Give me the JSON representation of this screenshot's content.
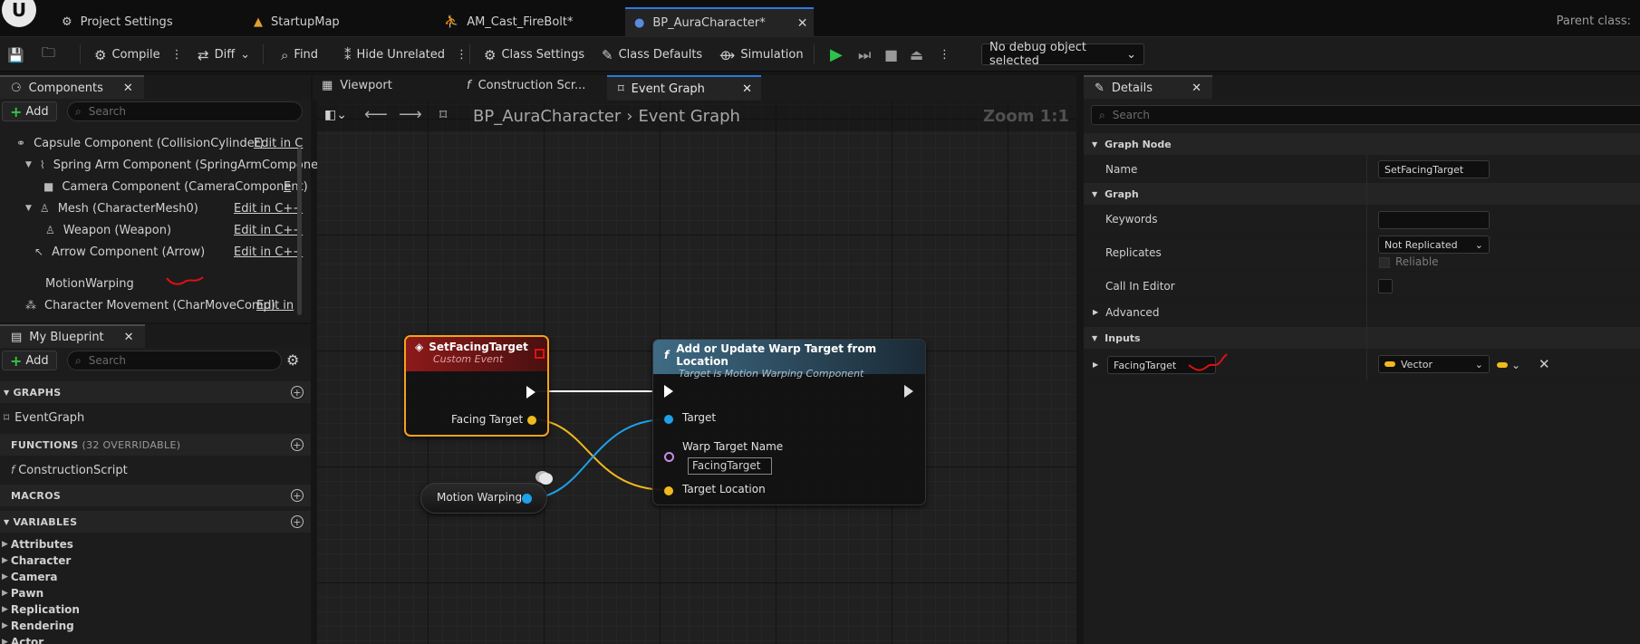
{
  "tabs": [
    {
      "label": "Project Settings",
      "icon": "settings-icon"
    },
    {
      "label": "StartupMap",
      "icon": "map-icon"
    },
    {
      "label": "AM_Cast_FireBolt*",
      "icon": "montage-icon"
    },
    {
      "label": "BP_AuraCharacter*",
      "icon": "character-icon",
      "active": true
    }
  ],
  "parent_class_label": "Parent class:",
  "toolbar": {
    "compile": "Compile",
    "diff": "Diff",
    "find": "Find",
    "hide_unrelated": "Hide Unrelated",
    "class_settings": "Class Settings",
    "class_defaults": "Class Defaults",
    "simulation": "Simulation",
    "debug_object": "No debug object selected"
  },
  "components": {
    "title": "Components",
    "add_label": "Add",
    "search_placeholder": "Search",
    "items": [
      {
        "label": "Capsule Component (CollisionCylinder)",
        "edit": "Edit in C"
      },
      {
        "label": "Spring Arm Component (SpringArmComponen",
        "edit": ""
      },
      {
        "label": "Camera Component (CameraComponent)",
        "edit": "E"
      },
      {
        "label": "Mesh (CharacterMesh0)",
        "edit": "Edit in C++"
      },
      {
        "label": "Weapon (Weapon)",
        "edit": "Edit in C++"
      },
      {
        "label": "Arrow Component (Arrow)",
        "edit": "Edit in C++"
      },
      {
        "label": "MotionWarping",
        "edit": ""
      },
      {
        "label": "Character Movement (CharMoveComp)",
        "edit": "Edit in"
      }
    ]
  },
  "my_blueprint": {
    "title": "My Blueprint",
    "add_label": "Add",
    "search_placeholder": "Search",
    "graphs_header": "GRAPHS",
    "graph_item": "EventGraph",
    "functions_header": "FUNCTIONS",
    "functions_count": "(32 OVERRIDABLE)",
    "function_item": "ConstructionScript",
    "macros_header": "MACROS",
    "variables_header": "VARIABLES",
    "variables": [
      "Attributes",
      "Character",
      "Camera",
      "Pawn",
      "Replication",
      "Rendering",
      "Actor"
    ]
  },
  "editor_tabs": [
    {
      "label": "Viewport"
    },
    {
      "label": "Construction Scr..."
    },
    {
      "label": "Event Graph",
      "active": true
    }
  ],
  "graph": {
    "breadcrumb_root": "BP_AuraCharacter",
    "breadcrumb_current": "Event Graph",
    "zoom": "Zoom 1:1",
    "event_node": {
      "title": "SetFacingTarget",
      "subtitle": "Custom Event",
      "pin": "Facing Target"
    },
    "function_node": {
      "title": "Add or Update Warp Target from Location",
      "subtitle": "Target is Motion Warping Component",
      "pin_target": "Target",
      "pin_warp_name": "Warp Target Name",
      "warp_name_value": "FacingTarget",
      "pin_location": "Target Location"
    },
    "var_node": {
      "label": "Motion Warping"
    }
  },
  "details": {
    "title": "Details",
    "search_placeholder": "Search",
    "graph_node_section": "Graph Node",
    "name_label": "Name",
    "name_value": "SetFacingTarget",
    "graph_section": "Graph",
    "keywords_label": "Keywords",
    "replicates_label": "Replicates",
    "replicates_value": "Not Replicated",
    "reliable_label": "Reliable",
    "call_in_editor_label": "Call In Editor",
    "advanced_label": "Advanced",
    "inputs_section": "Inputs",
    "input_name": "FacingTarget",
    "input_type": "Vector"
  },
  "colors": {
    "accent": "#2a7ae0",
    "event_header": "#8c1a1a",
    "function_header": "#3f6b85",
    "exec_wire": "#ffffff",
    "vector_pin": "#f0b91e",
    "object_pin": "#1ea0ea",
    "name_pin": "#c88ce6",
    "play": "#2ec24a",
    "annotation": "#e01010"
  }
}
